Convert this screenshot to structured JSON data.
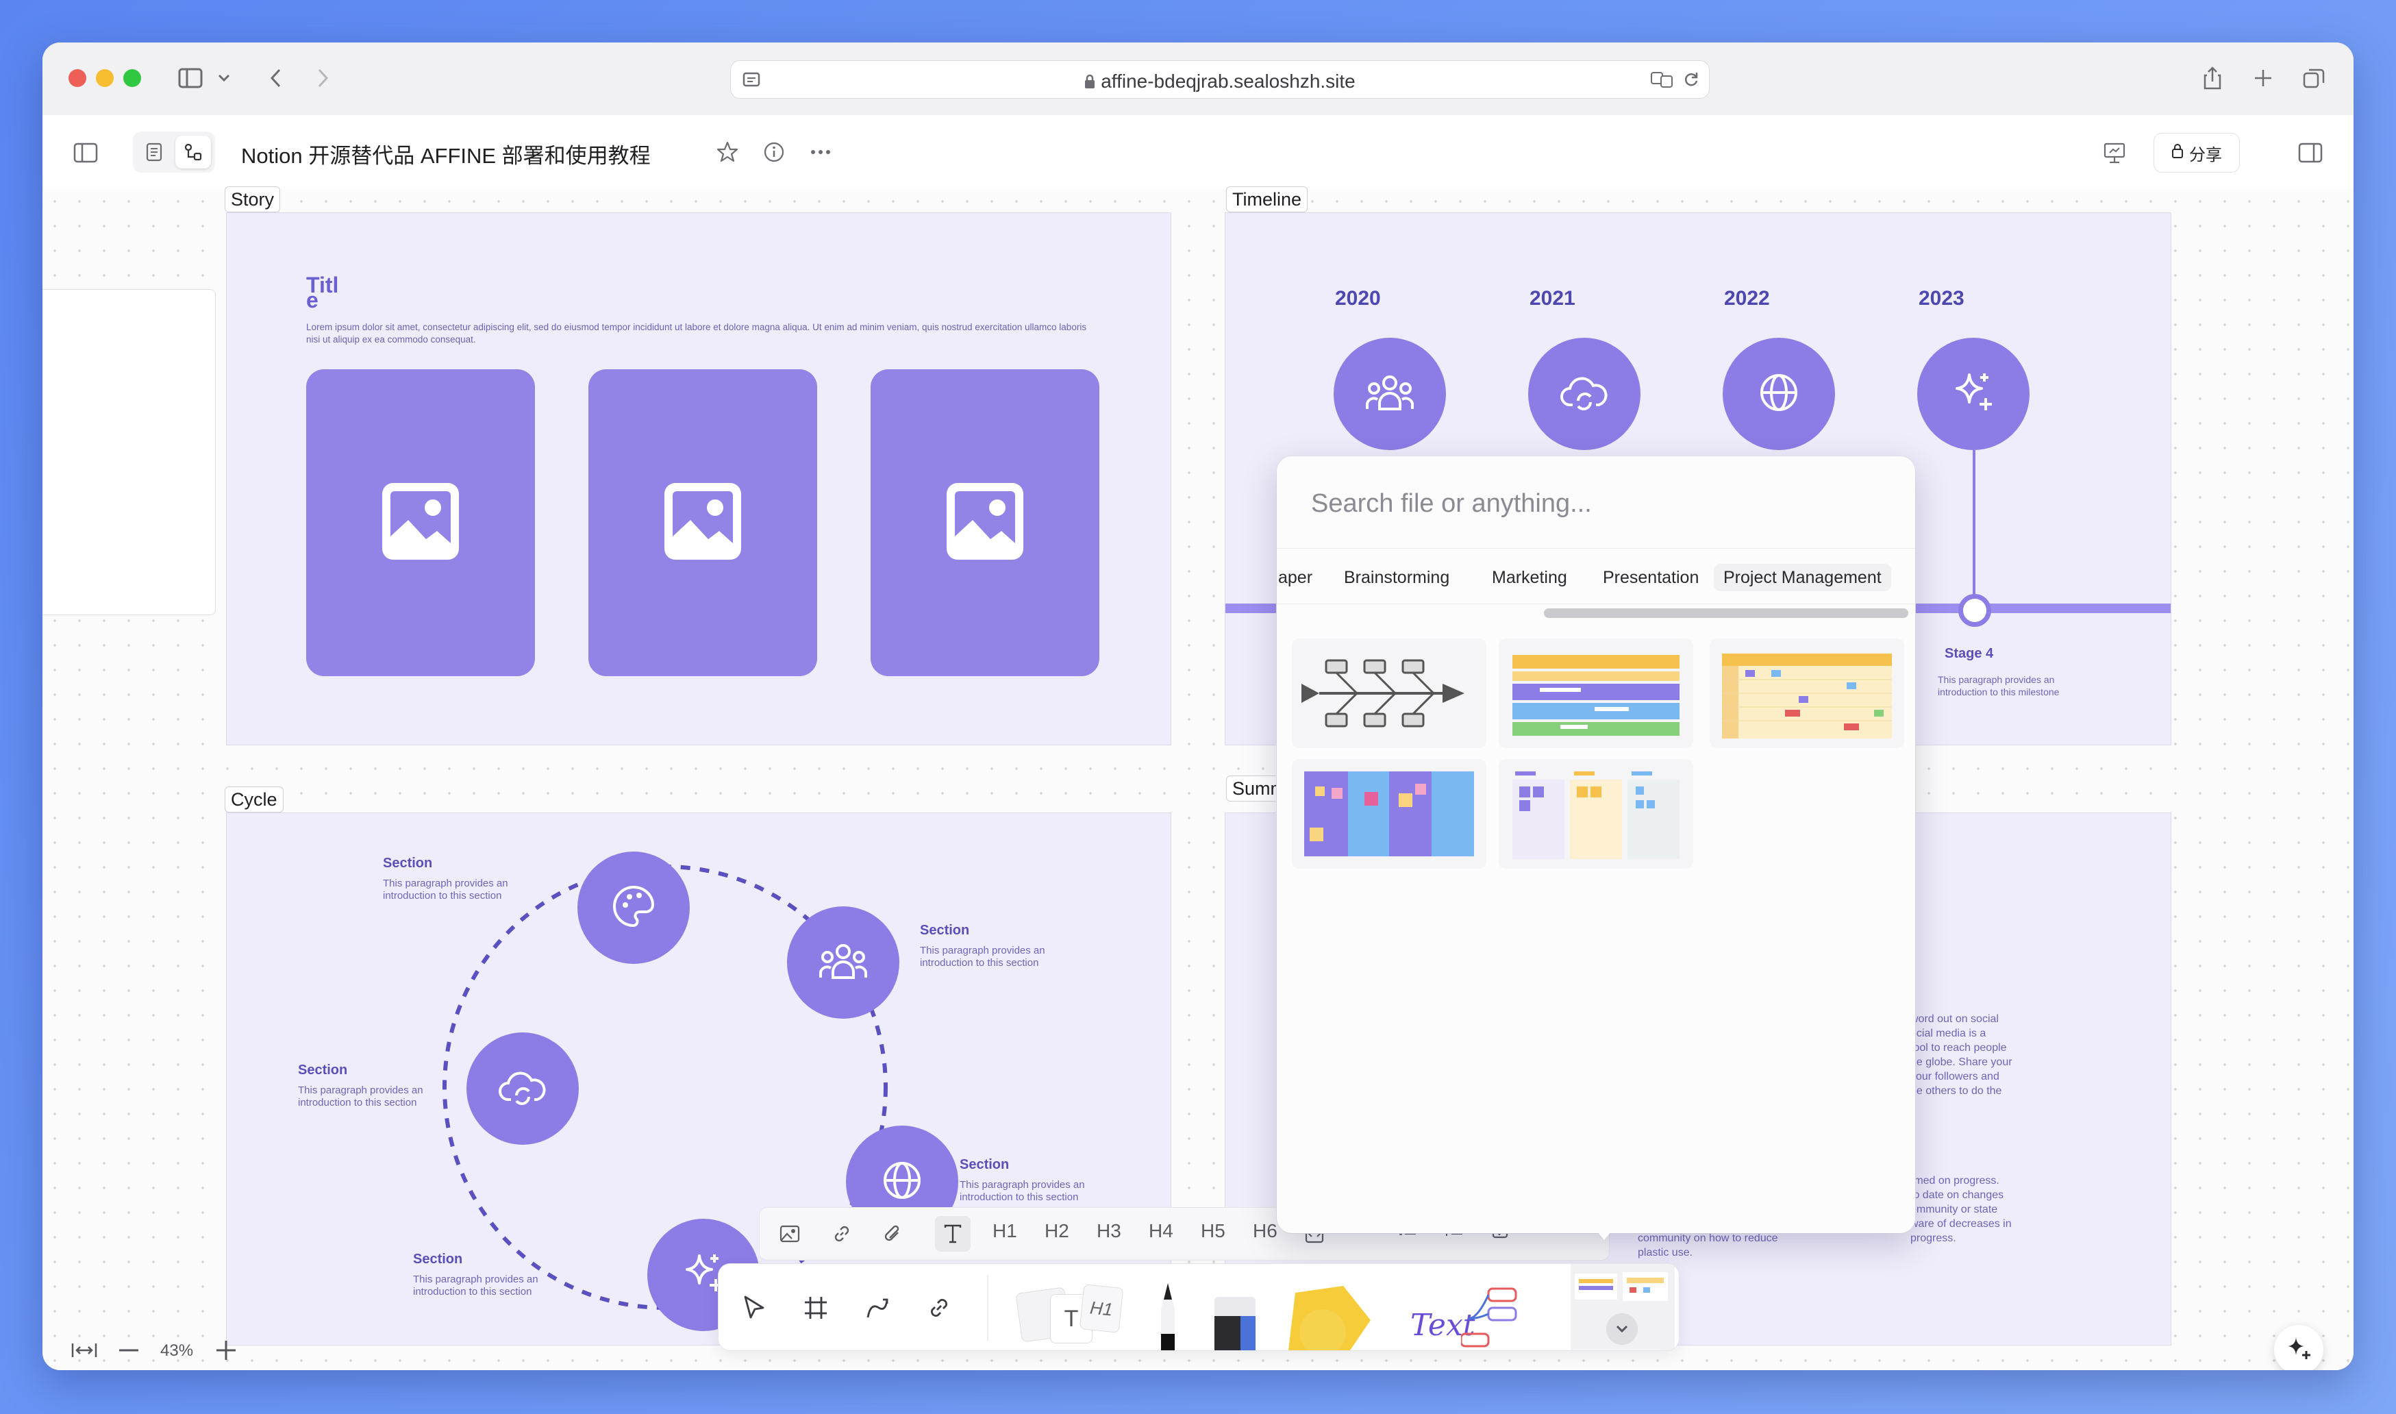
{
  "browser": {
    "url": "affine-bdeqjrab.sealoshzh.site"
  },
  "toolbar": {
    "doc_title": "Notion 开源替代品 AFFINE 部署和使用教程",
    "share_label": "分享"
  },
  "frames": {
    "story": {
      "label": "Story",
      "title": "Titl\ne",
      "body": "Lorem ipsum dolor sit amet, consectetur adipiscing elit, sed do eiusmod tempor incididunt ut labore et dolore magna aliqua. Ut enim ad minim veniam, quis nostrud exercitation ullamco laboris nisi ut aliquip ex ea commodo consequat."
    },
    "timeline": {
      "label": "Timeline",
      "years": [
        "2020",
        "2021",
        "2022",
        "2023"
      ],
      "stage_title": "Stage 4",
      "stage_text": "This paragraph provides an introduction to this milestone"
    },
    "cycle": {
      "label": "Cycle",
      "sections": [
        {
          "title": "Section",
          "text": "This paragraph provides an introduction to this section"
        },
        {
          "title": "Section",
          "text": "This paragraph provides an introduction to this section"
        },
        {
          "title": "Section",
          "text": "This paragraph provides an introduction to this section"
        },
        {
          "title": "Section",
          "text": "This paragraph provides an introduction to this section"
        },
        {
          "title": "Section",
          "text": "This paragraph provides an introduction to this section"
        }
      ]
    },
    "summary": {
      "label": "Summ",
      "text1": "word out on social\nocial media is a\ntool to reach people\nhe globe. Share your\nyour followers and\nge others to do the",
      "text2": "rmed on progress.\nto date on changes\nommunity or state\nware of decreases in\nprogress.",
      "text3": "community on how to reduce\nplastic use."
    }
  },
  "template_popup": {
    "search_placeholder": "Search file or anything...",
    "tabs": [
      "aper",
      "Brainstorming",
      "Marketing",
      "Presentation",
      "Project Management"
    ],
    "active_tab": "Project Management"
  },
  "format_bar": {
    "headings": [
      "H1",
      "H2",
      "H3",
      "H4",
      "H5",
      "H6"
    ]
  },
  "tools": {
    "text_tile_label": "Text",
    "text_card_h1": "H1"
  },
  "zoom": {
    "level": "43%"
  },
  "colors": {
    "accent": "#8c7ce6",
    "frame_bg": "#efecfb",
    "desktop": "#6a95f5"
  }
}
